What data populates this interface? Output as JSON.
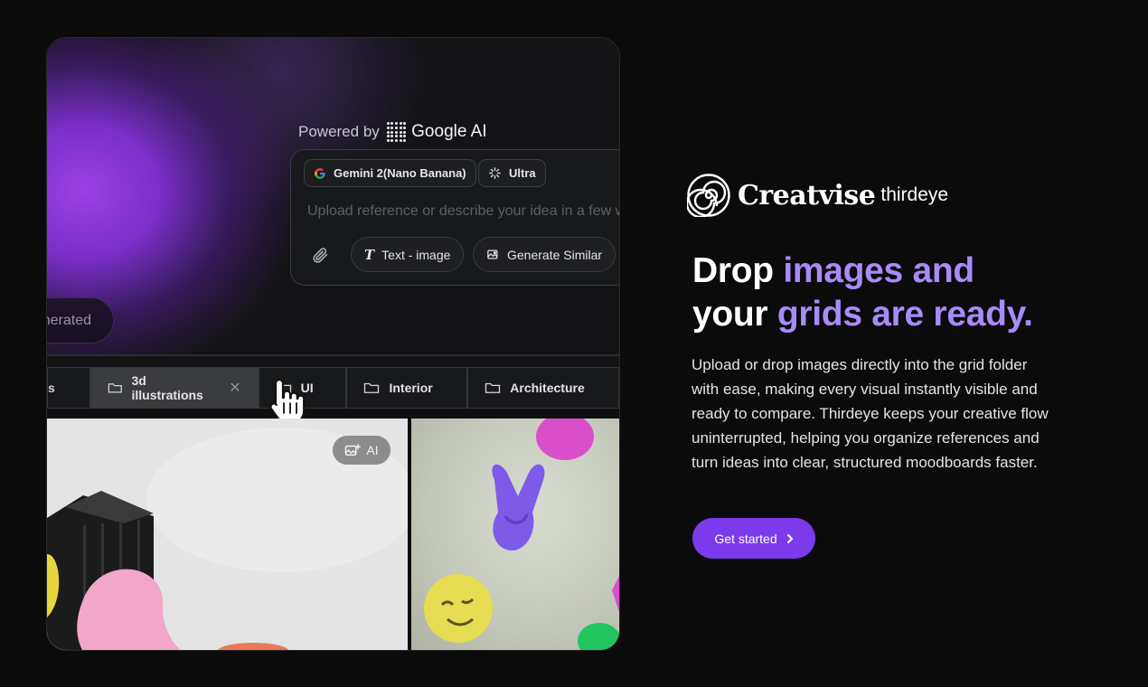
{
  "preview": {
    "powered_prefix": "Powered by",
    "powered_brand": "Google AI",
    "model_chip": "Gemini 2(Nano Banana)",
    "quality_chip": "Ultra",
    "prompt_placeholder": "Upload reference or describe your idea in a few w",
    "text_image_label": "Text - image",
    "generate_similar_label": "Generate Similar",
    "generated_pill": "nerated",
    "tabs": [
      {
        "label": "s"
      },
      {
        "label": "3d illustrations",
        "active": true
      },
      {
        "label": "UI"
      },
      {
        "label": "Interior"
      },
      {
        "label": "Architecture"
      }
    ],
    "ai_badge": "AI"
  },
  "brand": {
    "logo_word": "Creatvise",
    "logo_sub": "thirdeye"
  },
  "hero": {
    "headline_line1_a": "Drop ",
    "headline_line1_b": "images and",
    "headline_line2_a": "your ",
    "headline_line2_b": "grids are ready.",
    "description": "Upload or drop images directly into the grid folder with ease, making every visual instantly visible and ready to compare. Thirdeye keeps your creative flow uninterrupted, helping you organize references and turn ideas into clear, structured moodboards faster.",
    "cta_label": "Get started"
  },
  "colors": {
    "accent": "#7c3aed",
    "headline_accent": "#a78bfa",
    "background": "#0b0b0c"
  }
}
